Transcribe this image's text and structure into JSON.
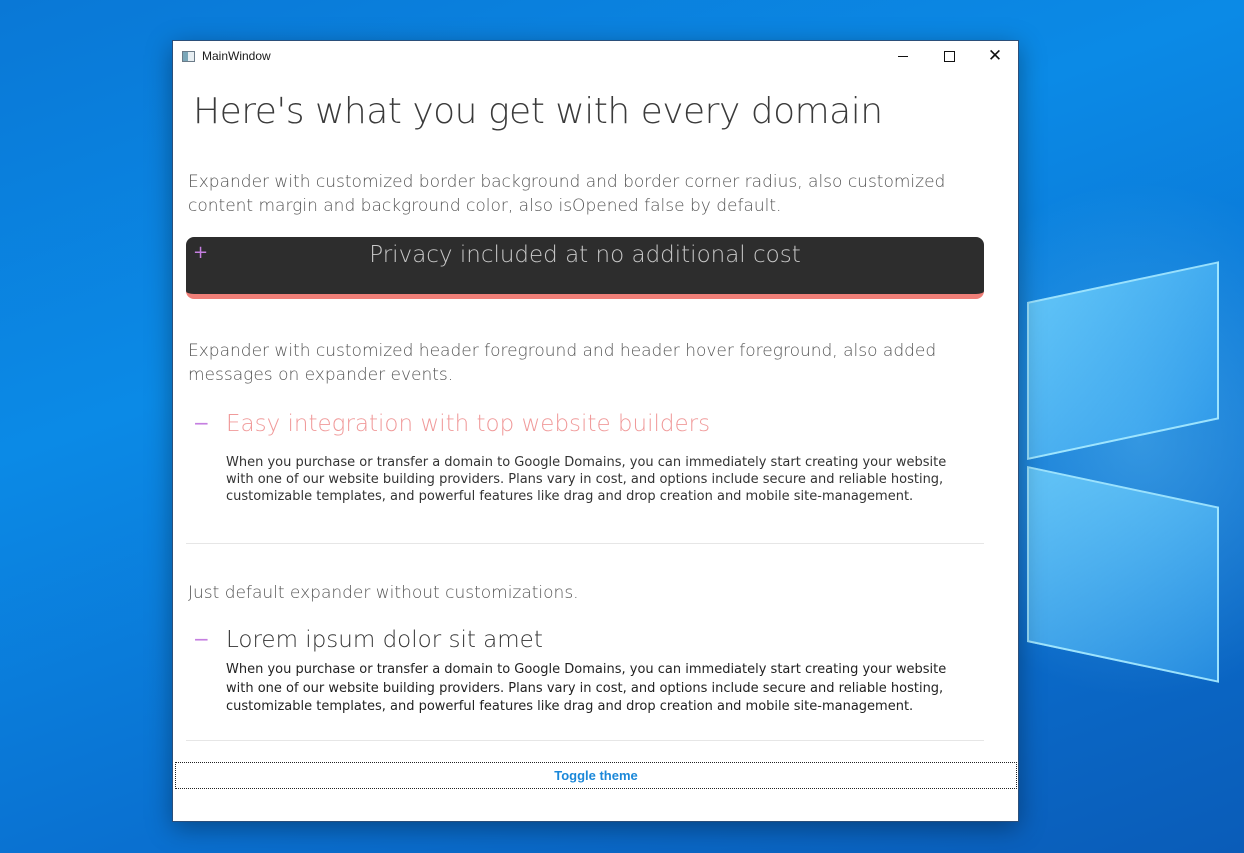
{
  "window": {
    "title": "MainWindow"
  },
  "heading": "Here's what you get with every domain",
  "descriptions": {
    "first": "Expander with customized border background and border corner radius, also customized content margin and background color, also isOpened false by default.",
    "second": "Expander with customized header foreground and header hover foreground, also added messages on expander events.",
    "third": "Just default expander without customizations."
  },
  "expanders": [
    {
      "toggle": "+",
      "header": "Privacy included at no additional cost",
      "opened": false
    },
    {
      "toggle": "−",
      "header": "Easy integration with top website builders",
      "opened": true,
      "body": "When you purchase or transfer a domain to Google Domains, you can immediately start creating your website with one of our website building providers. Plans vary in cost, and options include secure and reliable hosting, customizable templates, and powerful features like drag and drop creation and mobile site-management."
    },
    {
      "toggle": "−",
      "header": "Lorem ipsum dolor sit amet",
      "opened": true,
      "body": "When you purchase or transfer a domain to Google Domains, you can immediately start creating your website with one of our website building providers. Plans vary in cost, and options include secure and reliable hosting, customizable templates, and powerful features like drag and drop creation and mobile site-management."
    }
  ],
  "toggle_theme_label": "Toggle theme",
  "colors": {
    "dark_header_bg": "#2d2d2d",
    "dark_border": "#f07f78",
    "toggle_glyph": "#c57fe0",
    "custom_header_fg": "#f09a9a",
    "button_text": "#1b88d9"
  }
}
